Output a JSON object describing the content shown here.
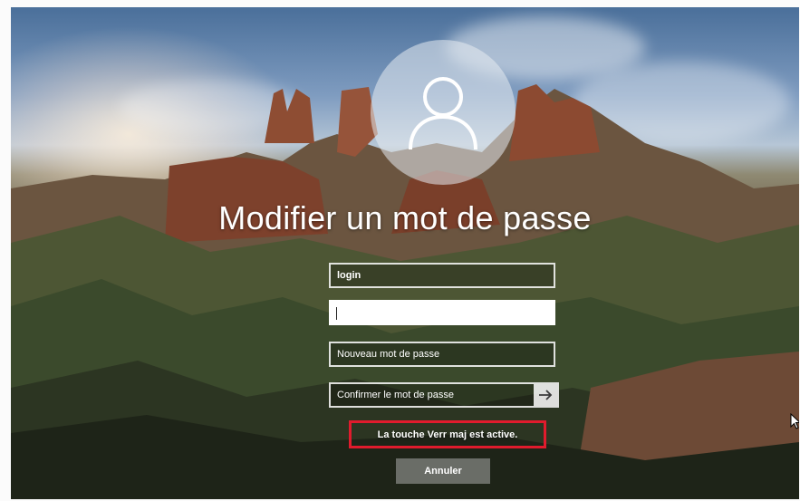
{
  "screen": {
    "title": "Modifier un mot de passe"
  },
  "form": {
    "login_value": "login",
    "current_password_value": "",
    "new_password_placeholder": "Nouveau mot de passe",
    "confirm_password_placeholder": "Confirmer le mot de passe",
    "submit_icon": "arrow-right-icon"
  },
  "warning": {
    "caps_lock_text": "La touche Verr maj est active.",
    "highlight_color": "#e01b2d"
  },
  "actions": {
    "cancel_label": "Annuler"
  },
  "icons": {
    "avatar": "user-avatar-icon",
    "pointer": "mouse-pointer-icon"
  }
}
